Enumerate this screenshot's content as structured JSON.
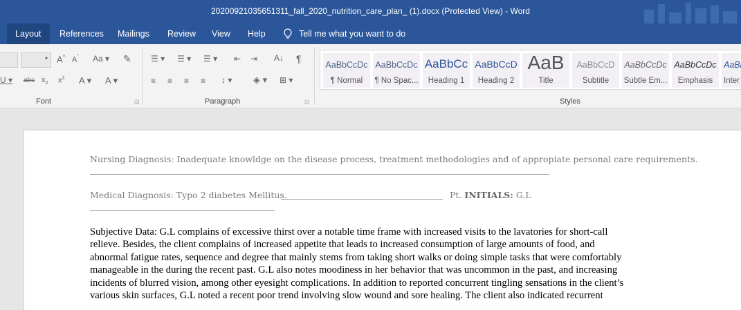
{
  "window": {
    "title": "20200921035651311_fall_2020_nutrition_care_plan_ (1).docx (Protected View)  -  Word"
  },
  "tabs": {
    "items": [
      "Layout",
      "References",
      "Mailings",
      "Review",
      "View",
      "Help"
    ],
    "active": "Layout",
    "tell_me": "Tell me what you want to do"
  },
  "ribbon": {
    "font_group_label": "Font",
    "paragraph_group_label": "Paragraph",
    "styles_group_label": "Styles",
    "styles": [
      {
        "preview": "AaBbCcDc",
        "name": "¶ Normal"
      },
      {
        "preview": "AaBbCcDc",
        "name": "¶ No Spac..."
      },
      {
        "preview": "AaBbCc",
        "name": "Heading 1"
      },
      {
        "preview": "AaBbCcD",
        "name": "Heading 2"
      },
      {
        "preview": "AaB",
        "name": "Title"
      },
      {
        "preview": "AaBbCcD",
        "name": "Subtitle"
      },
      {
        "preview": "AaBbCcDc",
        "name": "Subtle Em..."
      },
      {
        "preview": "AaBbCcDc",
        "name": "Emphasis"
      },
      {
        "preview": "AaBb",
        "name": "Inter"
      }
    ]
  },
  "document": {
    "nursing_diagnosis": "Nursing Diagnosis: Inadequate knowldge on the disease process, treatment methodologies and of appropiate personal care requirements.",
    "medical_diagnosis": "Medical Diagnosis: Typo 2 diabetes Mellitus.",
    "pt_label": "Pt.",
    "initials_label": "INITIALS:",
    "initials_value": "G.L",
    "subjective_lines": [
      "Subjective Data: G.L complains of excessive thirst over a notable time frame with increased visits to the lavatories for short-call",
      "relieve. Besides, the client complains of increased appetite that leads to increased consumption  of large amounts of food, and",
      "abnormal fatigue rates, sequence and degree that mainly stems from taking short walks or doing simple tasks that were comfortably",
      "manageable in the during the recent past. G.L also notes moodiness in her behavior that was uncommon in the past, and increasing",
      "incidents of blurred vision, among other eyesight complications. In addition to reported concurrent tingling sensations in the client’s",
      "various skin surfaces, G.L noted a recent poor trend involving slow wound and sore healing. The client also indicated recurrent"
    ]
  }
}
